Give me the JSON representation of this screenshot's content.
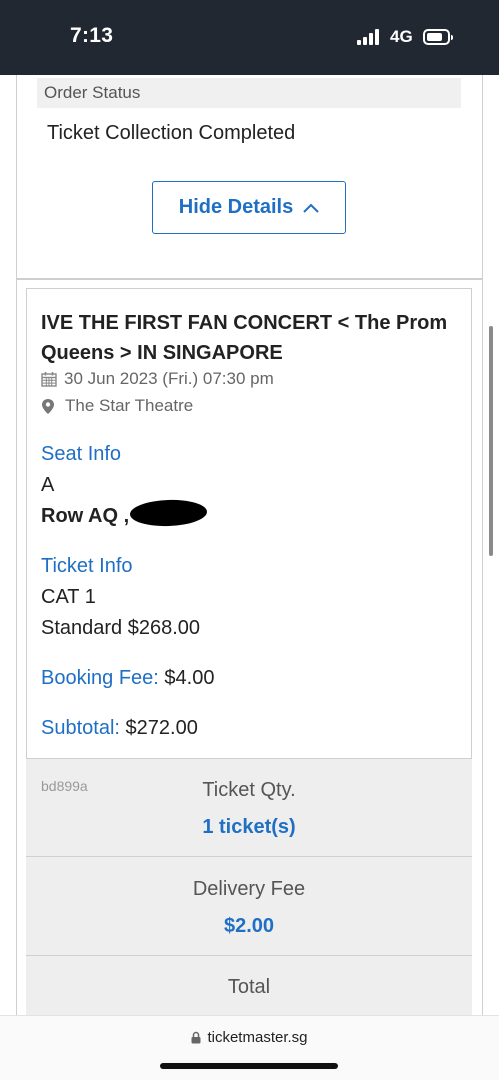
{
  "status_bar": {
    "time": "7:13",
    "network": "4G"
  },
  "order": {
    "status_label": "Order Status",
    "status_value": "Ticket Collection Completed",
    "hide_details_label": "Hide Details"
  },
  "event": {
    "title": "IVE THE FIRST FAN CONCERT < The Prom Queens > IN SINGAPORE",
    "datetime": "30 Jun 2023 (Fri.) 07:30 pm",
    "venue": "The Star Theatre"
  },
  "seat": {
    "heading": "Seat Info",
    "section": "A",
    "row": "Row AQ ,"
  },
  "ticket": {
    "heading": "Ticket Info",
    "category": "CAT 1",
    "price_line": "Standard $268.00"
  },
  "fees": {
    "booking_label": "Booking Fee:",
    "booking_value": "$4.00",
    "subtotal_label": "Subtotal:",
    "subtotal_value": "$272.00"
  },
  "summary": {
    "ref_code": "bd899a",
    "qty_label": "Ticket Qty.",
    "qty_value": "1 ticket(s)",
    "delivery_label": "Delivery Fee",
    "delivery_value": "$2.00",
    "total_label": "Total"
  },
  "browser": {
    "url": "ticketmaster.sg"
  },
  "colors": {
    "accent": "#1f6fc5",
    "status_bar": "#222831",
    "section_bg": "#eeeeee"
  }
}
